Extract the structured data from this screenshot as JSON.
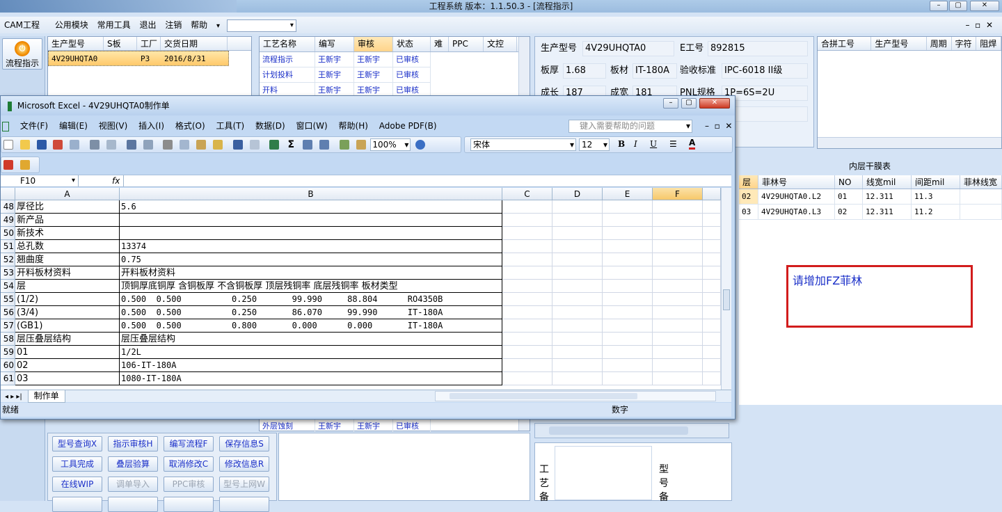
{
  "app": {
    "title": "工程系统   版本：1.1.50.3 - [流程指示]",
    "menu": [
      "CAM工程",
      "公用模块",
      "常用工具",
      "退出",
      "注销",
      "帮助"
    ],
    "flow_button": "流程指示"
  },
  "order_grid": {
    "headers": [
      "生产型号",
      "S板",
      "工厂",
      "交货日期"
    ],
    "rows": [
      [
        "4V29UHQTA0",
        "",
        "P3",
        "2016/8/31"
      ]
    ]
  },
  "process_grid": {
    "headers": [
      "工艺名称",
      "编写",
      "审核",
      "状态",
      "难",
      "PPC",
      "文控"
    ],
    "rows": [
      [
        "流程指示",
        "王新宇",
        "王新宇",
        "已审核"
      ],
      [
        "计划投料",
        "王新宇",
        "王新宇",
        "已审核"
      ],
      [
        "开料",
        "王新宇",
        "王新宇",
        "已审核"
      ]
    ],
    "bottom_row": [
      "外层蚀刻",
      "王新宇",
      "王新宇",
      "已审核"
    ]
  },
  "info": {
    "model_label": "生产型号",
    "model": "4V29UHQTA0",
    "eno_label": "E工号",
    "eno": "892815",
    "thick_label": "板厚",
    "thick": "1.68",
    "mat_label": "板材",
    "mat": "IT-180A",
    "std_label": "验收标准",
    "std": "IPC-6018 II级",
    "len_label": "成长",
    "len": "187",
    "wid_label": "成宽",
    "wid": "181",
    "pnl_label": "PNL规格",
    "pnl": "1P=6S=2U"
  },
  "merge_grid": {
    "headers": [
      "合拼工号",
      "生产型号",
      "周期",
      "字符",
      "阻焊"
    ]
  },
  "film_table": {
    "title": "内层干膜表",
    "headers": [
      "层",
      "菲林号",
      "NO",
      "线宽mil",
      "间距mil",
      "菲林线宽"
    ],
    "rows": [
      [
        "02",
        "4V29UHQTA0.L2",
        "01",
        "12.311",
        "11.3",
        ""
      ],
      [
        "03",
        "4V29UHQTA0.L3",
        "02",
        "12.311",
        "11.2",
        ""
      ]
    ]
  },
  "note_text": "请增加FZ菲林",
  "action_buttons": [
    {
      "label": "型号查询X",
      "disabled": false
    },
    {
      "label": "指示审核H",
      "disabled": false
    },
    {
      "label": "编写流程F",
      "disabled": false
    },
    {
      "label": "保存信息S",
      "disabled": false
    },
    {
      "label": "工具完成",
      "disabled": false
    },
    {
      "label": "叠层验算",
      "disabled": false
    },
    {
      "label": "取消修改C",
      "disabled": false
    },
    {
      "label": "修改信息R",
      "disabled": false
    },
    {
      "label": "在线WIP",
      "disabled": false
    },
    {
      "label": "调单导入",
      "disabled": true
    },
    {
      "label": "PPC审核",
      "disabled": true
    },
    {
      "label": "型号上网W",
      "disabled": true
    }
  ],
  "side_labels": {
    "process_note": "工艺备",
    "model_note": "型号备"
  },
  "excel": {
    "title": "Microsoft Excel - 4V29UHQTA0制作单",
    "menu": [
      "文件(F)",
      "编辑(E)",
      "视图(V)",
      "插入(I)",
      "格式(O)",
      "工具(T)",
      "数据(D)",
      "窗口(W)",
      "帮助(H)",
      "Adobe PDF(B)"
    ],
    "help_placeholder": "键入需要帮助的问题",
    "zoom": "100%",
    "font": "宋体",
    "font_size": "12",
    "name_box": "F10",
    "fx": "fx",
    "columns": [
      "A",
      "B",
      "C",
      "D",
      "E",
      "F"
    ],
    "rows": [
      {
        "n": "48",
        "a": "厚径比",
        "b": "5.6"
      },
      {
        "n": "49",
        "a": "新产品",
        "b": ""
      },
      {
        "n": "50",
        "a": "新技术",
        "b": ""
      },
      {
        "n": "51",
        "a": "总孔数",
        "b": "13374"
      },
      {
        "n": "52",
        "a": "翘曲度",
        "b": "0.75"
      },
      {
        "n": "53",
        "a": "开料板材资料",
        "b": "开料板材资料"
      },
      {
        "n": "54",
        "a": "层",
        "b": "顶铜厚底铜厚 含铜板厚 不含铜板厚 顶层残铜率 底层残铜率 板材类型"
      },
      {
        "n": "55",
        "a": "(1/2)",
        "b": "0.500  0.500          0.250       99.990     88.804      RO4350B"
      },
      {
        "n": "56",
        "a": "(3/4)",
        "b": "0.500  0.500          0.250       86.070     99.990      IT-180A"
      },
      {
        "n": "57",
        "a": "(GB1)",
        "b": "0.500  0.500          0.800       0.000      0.000       IT-180A"
      },
      {
        "n": "58",
        "a": "层压叠层结构",
        "b": "层压叠层结构"
      },
      {
        "n": "59",
        "a": "01",
        "b": "1/2L"
      },
      {
        "n": "60",
        "a": "02",
        "b": "106-IT-180A"
      },
      {
        "n": "61",
        "a": "03",
        "b": "1080-IT-180A"
      }
    ],
    "sheet_tab": "制作单",
    "status": "就绪",
    "status_num": "数字"
  }
}
